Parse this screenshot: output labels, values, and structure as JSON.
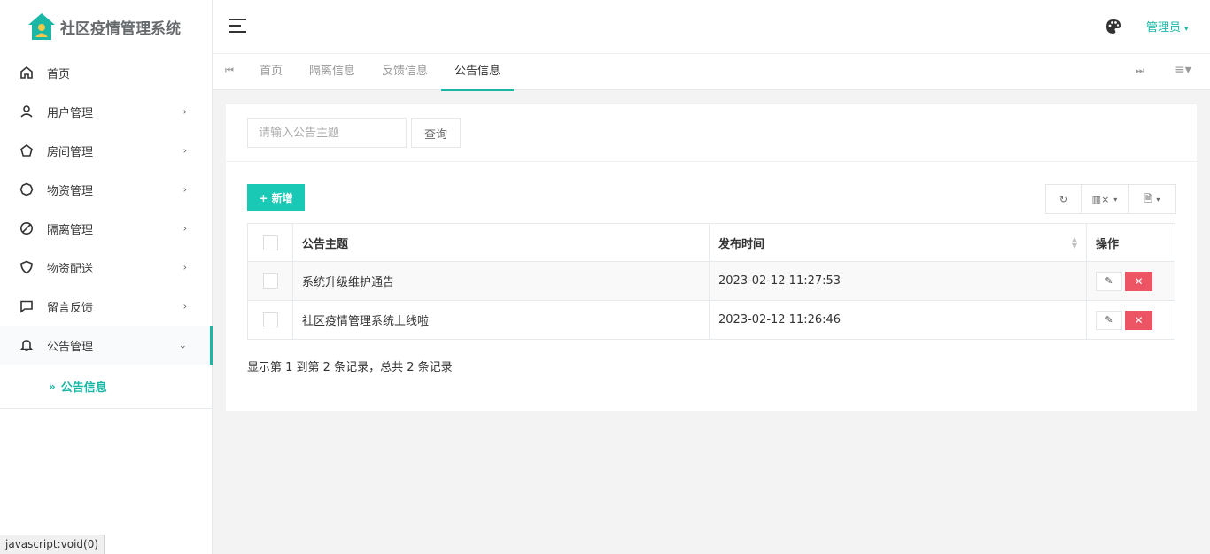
{
  "app": {
    "title": "社区疫情管理系统",
    "accent": "#1ab7a6",
    "logo_icon": "house-icon"
  },
  "sidebar": {
    "items": [
      {
        "label": "首页",
        "icon": "home-icon"
      },
      {
        "label": "用户管理",
        "icon": "user-icon",
        "chevron": "›"
      },
      {
        "label": "房间管理",
        "icon": "pentagon-icon",
        "chevron": "›"
      },
      {
        "label": "物资管理",
        "icon": "circle-icon",
        "chevron": "›"
      },
      {
        "label": "隔离管理",
        "icon": "ban-icon",
        "chevron": "›"
      },
      {
        "label": "物资配送",
        "icon": "shield-icon",
        "chevron": "›"
      },
      {
        "label": "留言反馈",
        "icon": "comment-icon",
        "chevron": "›"
      },
      {
        "label": "公告管理",
        "icon": "bell-icon",
        "chevron": "⌄"
      }
    ],
    "submenu": {
      "arrow": "»",
      "label": "公告信息"
    }
  },
  "header": {
    "menu_icon": "hamburger-icon",
    "theme_icon": "palette-icon",
    "user_label": "管理员",
    "user_caret": "▾"
  },
  "tabs": {
    "prev_icon": "⏮",
    "next_icon": "⏭",
    "menu_icon": "≡▾",
    "items": [
      {
        "label": "首页"
      },
      {
        "label": "隔离信息"
      },
      {
        "label": "反馈信息"
      },
      {
        "label": "公告信息",
        "active": true
      }
    ]
  },
  "search": {
    "placeholder": "请输入公告主题",
    "button_label": "查询"
  },
  "toolbar": {
    "add_label": "+ 新增",
    "refresh_icon": "↻",
    "columns_icon": "▥×",
    "export_icon": "🗎",
    "caret": "▾"
  },
  "table": {
    "columns": [
      "公告主题",
      "发布时间",
      "操作"
    ],
    "rows": [
      {
        "title": "系统升级维护通告",
        "time": "2023-02-12 11:27:53"
      },
      {
        "title": "社区疫情管理系统上线啦",
        "time": "2023-02-12 11:26:46"
      }
    ],
    "edit_icon": "✎",
    "delete_icon": "✕",
    "sort_icon": "▲▼"
  },
  "pager": {
    "text": "显示第 1 到第 2 条记录，总共 2 条记录"
  },
  "status_bar": {
    "text": "javascript:void(0)"
  }
}
